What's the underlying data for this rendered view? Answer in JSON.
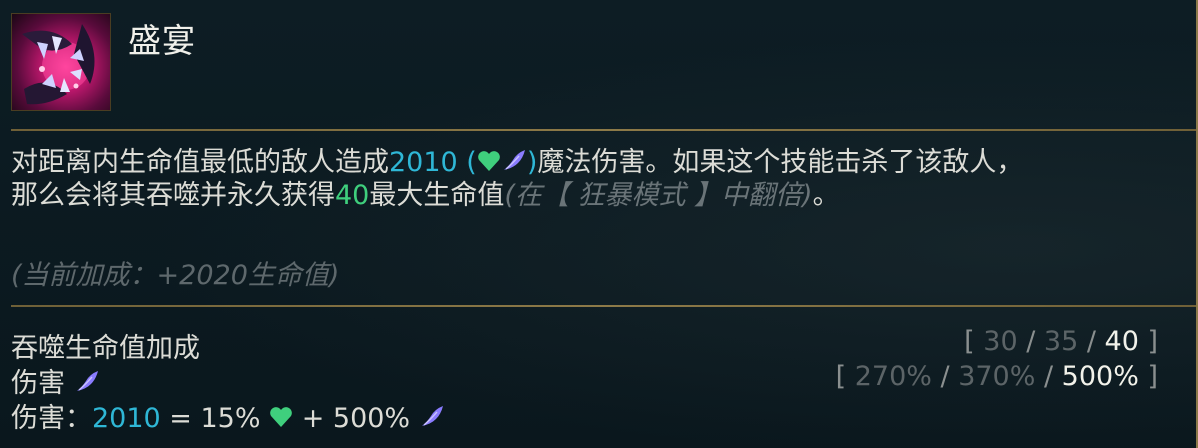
{
  "ability": {
    "name": "盛宴"
  },
  "description": {
    "part1": "对距离内生命值最低的敌人造成",
    "damage_value": "2010",
    "paren_open": " (",
    "paren_close": ")",
    "part2": "魔法伤害。如果这个技能击杀了该敌人，",
    "part3": "那么会将其吞噬并永久获得",
    "health_gain": "40",
    "part4": "最大生命值",
    "frenzy_note": "(在【 狂暴模式 】中翻倍)",
    "end": "。"
  },
  "current_bonus": "(当前加成：+2020生命值)",
  "stats": {
    "row1_label": "吞噬生命值加成",
    "row1_ranks": {
      "open": "[ ",
      "v1": "30",
      "sep1": " / ",
      "v2": "35",
      "sep2": " / ",
      "v3": "40",
      "close": " ]"
    },
    "row2_label": "伤害",
    "row2_ranks": {
      "open": "[ ",
      "v1": "270%",
      "sep1": " / ",
      "v2": "370%",
      "sep2": " / ",
      "v3": "500%",
      "close": " ]"
    },
    "row3_label": "伤害：",
    "row3_value": "2010",
    "row3_eq": " = 15% ",
    "row3_plus": " + 500% "
  },
  "colors": {
    "health_icon": "#3fcf7d",
    "ap_icon": "#8a7cff",
    "damage_blue": "#2fb7d6",
    "gold_border": "#8d7a48"
  },
  "icons": [
    "feast-ability-icon",
    "health-icon",
    "ability-power-icon"
  ]
}
